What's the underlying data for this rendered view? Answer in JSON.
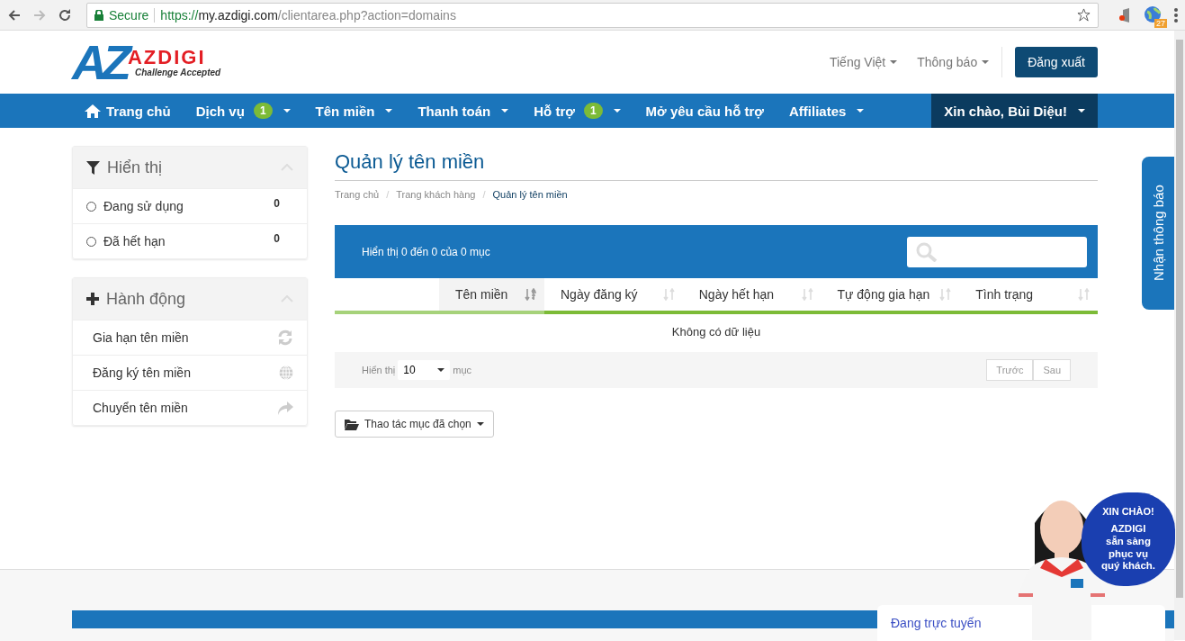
{
  "browser": {
    "secure_label": "Secure",
    "url_scheme": "https://",
    "url_host": "my.azdigi.com",
    "url_path": "/clientarea.php?action=domains",
    "extension_badge": "27"
  },
  "header": {
    "logo": {
      "mark": "AZ",
      "name": "AZDIGI",
      "tagline": "Challenge Accepted"
    },
    "links": [
      "Tiếng Việt",
      "Thông báo"
    ],
    "logout": "Đăng xuất"
  },
  "nav": {
    "items": [
      {
        "label": "Trang chủ",
        "dropdown": false
      },
      {
        "label": "Dịch vụ",
        "badge": "1",
        "dropdown": true
      },
      {
        "label": "Tên miền",
        "dropdown": true
      },
      {
        "label": "Thanh toán",
        "dropdown": true
      },
      {
        "label": "Hỗ trợ",
        "badge": "1",
        "dropdown": true
      },
      {
        "label": "Mở yêu cầu hỗ trợ",
        "dropdown": false
      },
      {
        "label": "Affiliates",
        "dropdown": true
      }
    ],
    "user": "Xin chào, Bùi Diệu!"
  },
  "sidebar": {
    "panels": [
      {
        "title": "Hiển thị",
        "kind": "filter",
        "items": [
          {
            "label": "Đang sử dụng",
            "count": "0",
            "selected": false
          },
          {
            "label": "Đã hết hạn",
            "count": "0",
            "selected": false
          }
        ]
      },
      {
        "title": "Hành động",
        "kind": "actions",
        "items": [
          {
            "label": "Gia hạn tên miền"
          },
          {
            "label": "Đăng ký tên miền"
          },
          {
            "label": "Chuyển tên miền"
          }
        ]
      }
    ]
  },
  "main": {
    "title": "Quản lý tên miền",
    "breadcrumb_separator": "/",
    "breadcrumb": [
      {
        "label": "Trang chủ",
        "selected": false
      },
      {
        "label": "Trang khách hàng",
        "selected": false
      },
      {
        "label": "Quản lý tên miền",
        "selected": true
      }
    ],
    "table": {
      "info": "Hiển thị 0 đến 0 của 0 mục",
      "columns": [
        {
          "label": "Tên miền",
          "selected": true
        },
        {
          "label": "Ngày đăng ký",
          "selected": false
        },
        {
          "label": "Ngày hết hạn",
          "selected": false
        },
        {
          "label": "Tự động gia hạn",
          "selected": false
        },
        {
          "label": "Tình trạng",
          "selected": false
        }
      ],
      "empty": "Không có dữ liệu",
      "length_label": "Hiển thị",
      "length_value": "10",
      "length_suffix": "mục",
      "pager": [
        {
          "label": "Trước",
          "disabled": true
        },
        {
          "label": "Sau",
          "disabled": true
        }
      ]
    },
    "bulk_button": "Thao tác mục đã chọn"
  },
  "side_tab": "Nhận thông báo",
  "promo": {
    "kind": "picture",
    "bubble": [
      "XIN CHÀO!",
      "AZDIGI",
      "sẵn sàng",
      "phục vụ",
      "quý khách."
    ]
  },
  "chat": {
    "title": "Đang trực tuyến"
  }
}
